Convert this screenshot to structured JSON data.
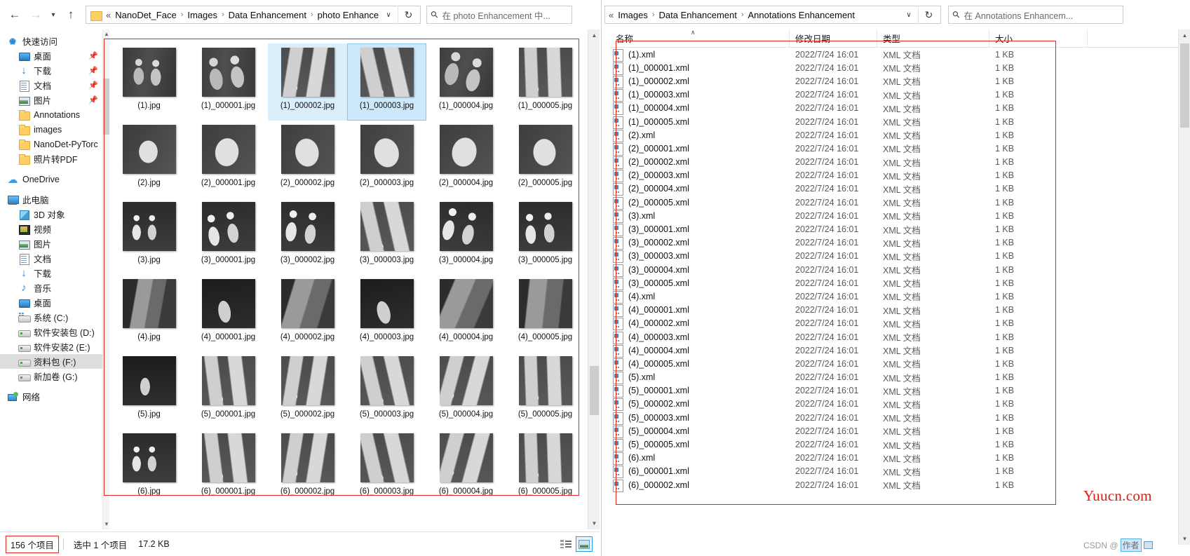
{
  "left_window": {
    "nav": {
      "back_icon": "back-arrow-icon",
      "forward_icon": "forward-arrow-icon",
      "recent_icon": "recent-locations-chevron-icon",
      "up_icon": "up-arrow-icon"
    },
    "breadcrumb": {
      "overflow": "«",
      "items": [
        "NanoDet_Face",
        "Images",
        "Data Enhancement",
        "photo Enhancement"
      ],
      "separator": "›",
      "caret": "∨",
      "refresh": "↻"
    },
    "search": {
      "placeholder": "在 photo Enhancement 中..."
    },
    "sidebar": {
      "groups": [
        {
          "label": "快速访问",
          "icon": "quick-access-star-icon",
          "items": [
            {
              "label": "桌面",
              "icon": "desktop-icon",
              "pinned": true
            },
            {
              "label": "下载",
              "icon": "downloads-icon",
              "pinned": true
            },
            {
              "label": "文档",
              "icon": "documents-icon",
              "pinned": true
            },
            {
              "label": "图片",
              "icon": "pictures-icon",
              "pinned": true
            },
            {
              "label": "Annotations",
              "icon": "folder-icon",
              "pinned": false
            },
            {
              "label": "images",
              "icon": "folder-icon",
              "pinned": false
            },
            {
              "label": "NanoDet-PyTorc",
              "icon": "folder-icon",
              "pinned": false
            },
            {
              "label": "照片转PDF",
              "icon": "folder-icon",
              "pinned": false
            }
          ]
        },
        {
          "label": "OneDrive",
          "icon": "onedrive-cloud-icon",
          "items": []
        },
        {
          "label": "此电脑",
          "icon": "this-pc-icon",
          "items": [
            {
              "label": "3D 对象",
              "icon": "3d-objects-icon",
              "pinned": false
            },
            {
              "label": "视频",
              "icon": "videos-icon",
              "pinned": false
            },
            {
              "label": "图片",
              "icon": "pictures-icon",
              "pinned": false
            },
            {
              "label": "文档",
              "icon": "documents-icon",
              "pinned": false
            },
            {
              "label": "下载",
              "icon": "downloads-icon",
              "pinned": false
            },
            {
              "label": "音乐",
              "icon": "music-icon",
              "pinned": false
            },
            {
              "label": "桌面",
              "icon": "desktop-icon",
              "pinned": false
            },
            {
              "label": "系统 (C:)",
              "icon": "system-drive-icon",
              "pinned": false
            },
            {
              "label": "软件安装包 (D:)",
              "icon": "drive-icon",
              "pinned": false
            },
            {
              "label": "软件安装2 (E:)",
              "icon": "drive-icon",
              "pinned": false
            },
            {
              "label": "资料包 (F:)",
              "icon": "drive-icon",
              "pinned": false,
              "selected": true
            },
            {
              "label": "新加卷 (G:)",
              "icon": "drive-icon",
              "pinned": false
            }
          ]
        },
        {
          "label": "网络",
          "icon": "network-icon",
          "items": []
        }
      ]
    },
    "thumbnails": [
      {
        "label": "(1).jpg",
        "art": "t-people",
        "rot": "rot0",
        "state": ""
      },
      {
        "label": "(1)_000001.jpg",
        "art": "t-people",
        "rot": "rot1",
        "state": ""
      },
      {
        "label": "(1)_000002.jpg",
        "art": "t-legs",
        "rot": "rot2",
        "state": "hover"
      },
      {
        "label": "(1)_000003.jpg",
        "art": "t-legs",
        "rot": "rot3",
        "state": "sel"
      },
      {
        "label": "(1)_000004.jpg",
        "art": "t-people",
        "rot": "rot4",
        "state": ""
      },
      {
        "label": "(1)_000005.jpg",
        "art": "t-legs",
        "rot": "rot5",
        "state": ""
      },
      {
        "label": "(2).jpg",
        "art": "t-face",
        "rot": "rot0",
        "state": ""
      },
      {
        "label": "(2)_000001.jpg",
        "art": "t-face",
        "rot": "rot2",
        "state": ""
      },
      {
        "label": "(2)_000002.jpg",
        "art": "t-face",
        "rot": "rot1",
        "state": ""
      },
      {
        "label": "(2)_000003.jpg",
        "art": "t-face",
        "rot": "rot3",
        "state": ""
      },
      {
        "label": "(2)_000004.jpg",
        "art": "t-face",
        "rot": "rot4",
        "state": ""
      },
      {
        "label": "(2)_000005.jpg",
        "art": "t-face",
        "rot": "rot5",
        "state": ""
      },
      {
        "label": "(3).jpg",
        "art": "t-group",
        "rot": "rot0",
        "state": ""
      },
      {
        "label": "(3)_000001.jpg",
        "art": "t-group",
        "rot": "rot1",
        "state": ""
      },
      {
        "label": "(3)_000002.jpg",
        "art": "t-group",
        "rot": "rot2",
        "state": ""
      },
      {
        "label": "(3)_000003.jpg",
        "art": "t-legs",
        "rot": "rot3",
        "state": ""
      },
      {
        "label": "(3)_000004.jpg",
        "art": "t-group",
        "rot": "rot4",
        "state": ""
      },
      {
        "label": "(3)_000005.jpg",
        "art": "t-group",
        "rot": "rot5",
        "state": ""
      },
      {
        "label": "(4).jpg",
        "art": "t-street",
        "rot": "rot0",
        "state": ""
      },
      {
        "label": "(4)_000001.jpg",
        "art": "t-dark",
        "rot": "rot1",
        "state": ""
      },
      {
        "label": "(4)_000002.jpg",
        "art": "t-street",
        "rot": "rot2",
        "state": ""
      },
      {
        "label": "(4)_000003.jpg",
        "art": "t-dark",
        "rot": "rot3",
        "state": ""
      },
      {
        "label": "(4)_000004.jpg",
        "art": "t-street",
        "rot": "rot4",
        "state": ""
      },
      {
        "label": "(4)_000005.jpg",
        "art": "t-street",
        "rot": "rot5",
        "state": ""
      },
      {
        "label": "(5).jpg",
        "art": "t-dark",
        "rot": "rot0",
        "state": ""
      },
      {
        "label": "(5)_000001.jpg",
        "art": "t-legs",
        "rot": "rot1",
        "state": ""
      },
      {
        "label": "(5)_000002.jpg",
        "art": "t-legs",
        "rot": "rot2",
        "state": ""
      },
      {
        "label": "(5)_000003.jpg",
        "art": "t-legs",
        "rot": "rot3",
        "state": ""
      },
      {
        "label": "(5)_000004.jpg",
        "art": "t-legs",
        "rot": "rot4",
        "state": ""
      },
      {
        "label": "(5)_000005.jpg",
        "art": "t-legs",
        "rot": "rot5",
        "state": ""
      },
      {
        "label": "(6).jpg",
        "art": "t-group",
        "rot": "rot0",
        "state": ""
      },
      {
        "label": "(6)_000001.jpg",
        "art": "t-legs",
        "rot": "rot1",
        "state": ""
      },
      {
        "label": "(6)_000002.jpg",
        "art": "t-legs",
        "rot": "rot2",
        "state": ""
      },
      {
        "label": "(6)_000003.jpg",
        "art": "t-legs",
        "rot": "rot3",
        "state": ""
      },
      {
        "label": "(6)_000004.jpg",
        "art": "t-legs",
        "rot": "rot4",
        "state": ""
      },
      {
        "label": "(6)_000005.jpg",
        "art": "t-legs",
        "rot": "rot5",
        "state": ""
      }
    ],
    "statusbar": {
      "count": "156 个项目",
      "selection": "选中 1 个项目",
      "size": "17.2 KB",
      "view_details_icon": "details-view-icon",
      "view_large_icons_icon": "large-icons-view-icon"
    }
  },
  "right_window": {
    "breadcrumb": {
      "overflow": "«",
      "items": [
        "Images",
        "Data Enhancement",
        "Annotations Enhancement"
      ],
      "separator": "›",
      "caret": "∨",
      "refresh": "↻"
    },
    "search": {
      "placeholder": "在 Annotations Enhancem..."
    },
    "columns": [
      {
        "label": "名称",
        "sort": "∧"
      },
      {
        "label": "修改日期",
        "sort": ""
      },
      {
        "label": "类型",
        "sort": ""
      },
      {
        "label": "大小",
        "sort": ""
      }
    ],
    "files": [
      {
        "name": "(1).xml",
        "date": "2022/7/24 16:01",
        "type": "XML 文档",
        "size": "1 KB"
      },
      {
        "name": "(1)_000001.xml",
        "date": "2022/7/24 16:01",
        "type": "XML 文档",
        "size": "1 KB"
      },
      {
        "name": "(1)_000002.xml",
        "date": "2022/7/24 16:01",
        "type": "XML 文档",
        "size": "1 KB"
      },
      {
        "name": "(1)_000003.xml",
        "date": "2022/7/24 16:01",
        "type": "XML 文档",
        "size": "1 KB"
      },
      {
        "name": "(1)_000004.xml",
        "date": "2022/7/24 16:01",
        "type": "XML 文档",
        "size": "1 KB"
      },
      {
        "name": "(1)_000005.xml",
        "date": "2022/7/24 16:01",
        "type": "XML 文档",
        "size": "1 KB"
      },
      {
        "name": "(2).xml",
        "date": "2022/7/24 16:01",
        "type": "XML 文档",
        "size": "1 KB"
      },
      {
        "name": "(2)_000001.xml",
        "date": "2022/7/24 16:01",
        "type": "XML 文档",
        "size": "1 KB"
      },
      {
        "name": "(2)_000002.xml",
        "date": "2022/7/24 16:01",
        "type": "XML 文档",
        "size": "1 KB"
      },
      {
        "name": "(2)_000003.xml",
        "date": "2022/7/24 16:01",
        "type": "XML 文档",
        "size": "1 KB"
      },
      {
        "name": "(2)_000004.xml",
        "date": "2022/7/24 16:01",
        "type": "XML 文档",
        "size": "1 KB"
      },
      {
        "name": "(2)_000005.xml",
        "date": "2022/7/24 16:01",
        "type": "XML 文档",
        "size": "1 KB"
      },
      {
        "name": "(3).xml",
        "date": "2022/7/24 16:01",
        "type": "XML 文档",
        "size": "1 KB"
      },
      {
        "name": "(3)_000001.xml",
        "date": "2022/7/24 16:01",
        "type": "XML 文档",
        "size": "1 KB"
      },
      {
        "name": "(3)_000002.xml",
        "date": "2022/7/24 16:01",
        "type": "XML 文档",
        "size": "1 KB"
      },
      {
        "name": "(3)_000003.xml",
        "date": "2022/7/24 16:01",
        "type": "XML 文档",
        "size": "1 KB"
      },
      {
        "name": "(3)_000004.xml",
        "date": "2022/7/24 16:01",
        "type": "XML 文档",
        "size": "1 KB"
      },
      {
        "name": "(3)_000005.xml",
        "date": "2022/7/24 16:01",
        "type": "XML 文档",
        "size": "1 KB"
      },
      {
        "name": "(4).xml",
        "date": "2022/7/24 16:01",
        "type": "XML 文档",
        "size": "1 KB"
      },
      {
        "name": "(4)_000001.xml",
        "date": "2022/7/24 16:01",
        "type": "XML 文档",
        "size": "1 KB"
      },
      {
        "name": "(4)_000002.xml",
        "date": "2022/7/24 16:01",
        "type": "XML 文档",
        "size": "1 KB"
      },
      {
        "name": "(4)_000003.xml",
        "date": "2022/7/24 16:01",
        "type": "XML 文档",
        "size": "1 KB"
      },
      {
        "name": "(4)_000004.xml",
        "date": "2022/7/24 16:01",
        "type": "XML 文档",
        "size": "1 KB"
      },
      {
        "name": "(4)_000005.xml",
        "date": "2022/7/24 16:01",
        "type": "XML 文档",
        "size": "1 KB"
      },
      {
        "name": "(5).xml",
        "date": "2022/7/24 16:01",
        "type": "XML 文档",
        "size": "1 KB"
      },
      {
        "name": "(5)_000001.xml",
        "date": "2022/7/24 16:01",
        "type": "XML 文档",
        "size": "1 KB"
      },
      {
        "name": "(5)_000002.xml",
        "date": "2022/7/24 16:01",
        "type": "XML 文档",
        "size": "1 KB"
      },
      {
        "name": "(5)_000003.xml",
        "date": "2022/7/24 16:01",
        "type": "XML 文档",
        "size": "1 KB"
      },
      {
        "name": "(5)_000004.xml",
        "date": "2022/7/24 16:01",
        "type": "XML 文档",
        "size": "1 KB"
      },
      {
        "name": "(5)_000005.xml",
        "date": "2022/7/24 16:01",
        "type": "XML 文档",
        "size": "1 KB"
      },
      {
        "name": "(6).xml",
        "date": "2022/7/24 16:01",
        "type": "XML 文档",
        "size": "1 KB"
      },
      {
        "name": "(6)_000001.xml",
        "date": "2022/7/24 16:01",
        "type": "XML 文档",
        "size": "1 KB"
      },
      {
        "name": "(6)_000002.xml",
        "date": "2022/7/24 16:01",
        "type": "XML 文档",
        "size": "1 KB"
      }
    ]
  },
  "overlay": {
    "watermark": "Yuucn.com",
    "csdn_prefix": "CSDN @",
    "csdn_user": "作者"
  },
  "colors": {
    "annotation_red": "#e8261b",
    "selection_blue": "#cce8fa",
    "hover_blue": "#dbeefc",
    "accent_blue": "#29a0e4",
    "watermark_red": "#e01b10"
  }
}
